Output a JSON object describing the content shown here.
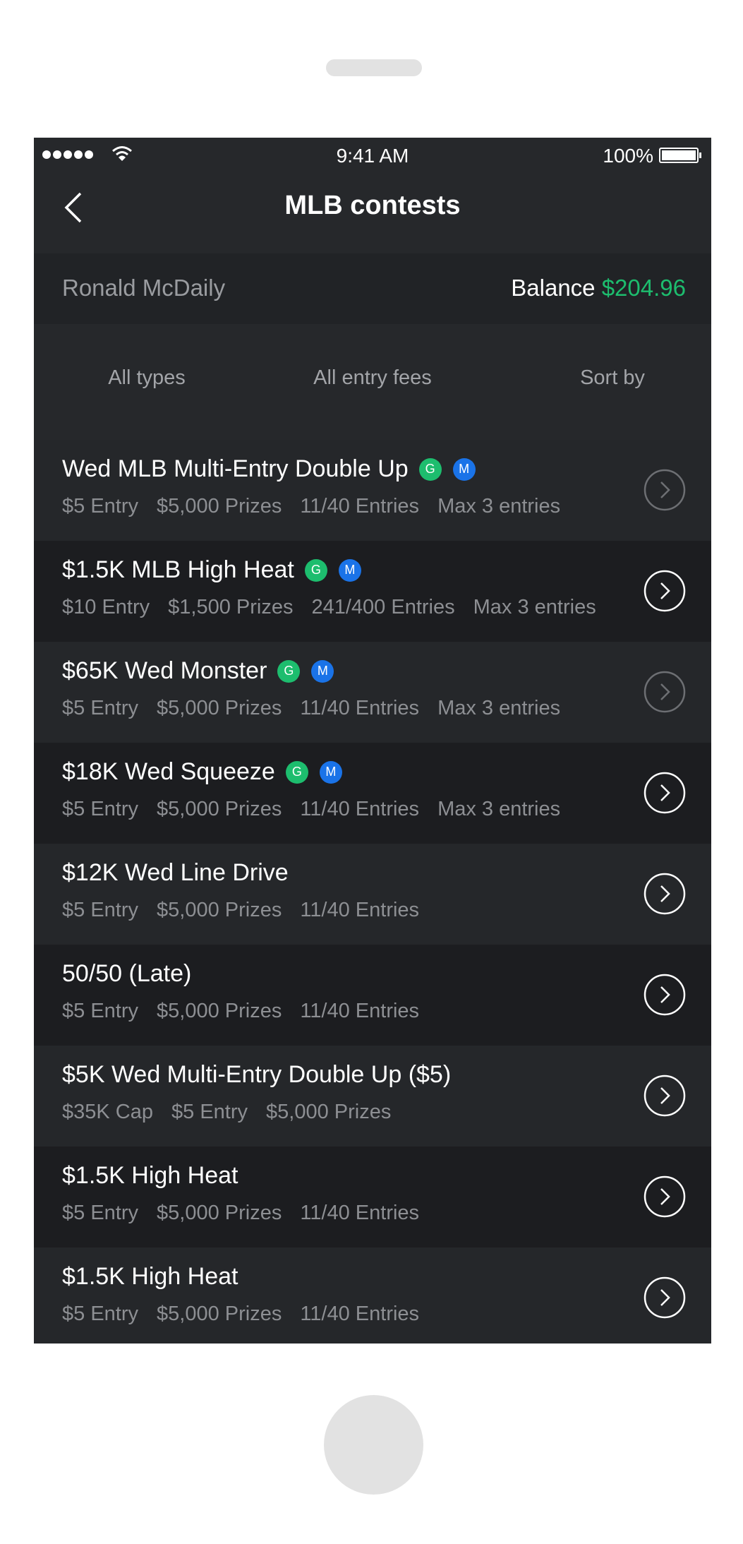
{
  "status": {
    "time": "9:41 AM",
    "battery": "100%"
  },
  "nav": {
    "title": "MLB contests"
  },
  "account": {
    "name": "Ronald McDaily",
    "balance_label": "Balance",
    "balance_value": "$204.96"
  },
  "filters": [
    "All types",
    "All entry fees",
    "Sort by"
  ],
  "badges": {
    "g": "G",
    "m": "M"
  },
  "colors": {
    "accent_green": "#1dbd6e",
    "accent_blue": "#1a73e8",
    "background": "#1c1d20"
  },
  "contests": [
    {
      "title": "Wed MLB Multi-Entry Double Up",
      "badges": [
        "g",
        "m"
      ],
      "meta": [
        "$5 Entry",
        "$5,000 Prizes",
        "11/40 Entries",
        "Max 3 entries"
      ],
      "dim_arrow": true
    },
    {
      "title": "$1.5K MLB High Heat",
      "badges": [
        "g",
        "m"
      ],
      "meta": [
        "$10 Entry",
        "$1,500 Prizes",
        "241/400 Entries",
        "Max 3 entries"
      ],
      "dim_arrow": false
    },
    {
      "title": "$65K Wed Monster",
      "badges": [
        "g",
        "m"
      ],
      "meta": [
        "$5 Entry",
        "$5,000 Prizes",
        "11/40 Entries",
        "Max 3 entries"
      ],
      "dim_arrow": true
    },
    {
      "title": "$18K Wed Squeeze",
      "badges": [
        "g",
        "m"
      ],
      "meta": [
        "$5 Entry",
        "$5,000 Prizes",
        "11/40 Entries",
        "Max 3 entries"
      ],
      "dim_arrow": false
    },
    {
      "title": "$12K Wed Line Drive",
      "badges": [],
      "meta": [
        "$5 Entry",
        "$5,000 Prizes",
        "11/40 Entries"
      ],
      "dim_arrow": false
    },
    {
      "title": "50/50 (Late)",
      "badges": [],
      "meta": [
        "$5 Entry",
        "$5,000 Prizes",
        "11/40 Entries"
      ],
      "dim_arrow": false
    },
    {
      "title": "$5K Wed Multi-Entry Double Up ($5)",
      "badges": [],
      "meta": [
        "$35K Cap",
        "$5 Entry",
        "$5,000 Prizes"
      ],
      "dim_arrow": false
    },
    {
      "title": "$1.5K  High Heat",
      "badges": [],
      "meta": [
        "$5 Entry",
        "$5,000 Prizes",
        "11/40 Entries"
      ],
      "dim_arrow": false
    },
    {
      "title": "$1.5K  High Heat",
      "badges": [],
      "meta": [
        "$5 Entry",
        "$5,000 Prizes",
        "11/40 Entries"
      ],
      "dim_arrow": false
    }
  ]
}
